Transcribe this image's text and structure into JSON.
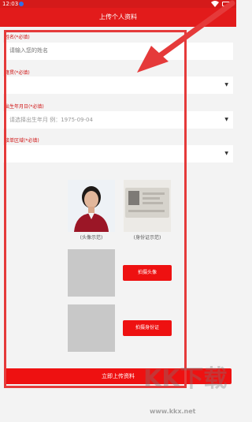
{
  "status_bar": {
    "time": "12:03"
  },
  "app_bar": {
    "title": "上传个人资料"
  },
  "form": {
    "name_label": "姓名(*必填)",
    "name_placeholder": "请输入您的姓名",
    "origin_label": "籍贯(*必填)",
    "birth_label": "出生年月日(*必填)",
    "birth_placeholder": "请选择出生年月 例：1975-09-04",
    "area_label": "接单区域(*必填)"
  },
  "samples": {
    "avatar_caption": "(头像示范)",
    "idcard_caption": "(身份证示范)"
  },
  "actions": {
    "take_avatar": "拍摄头像",
    "take_idcard": "拍摄身份证",
    "submit": "立即上传资料"
  },
  "watermark": {
    "brand": "KK下载",
    "url": "www.kkx.net"
  },
  "colors": {
    "brand_red": "#e21b1b",
    "button_red": "#ee1111",
    "label_red": "#d01414"
  }
}
